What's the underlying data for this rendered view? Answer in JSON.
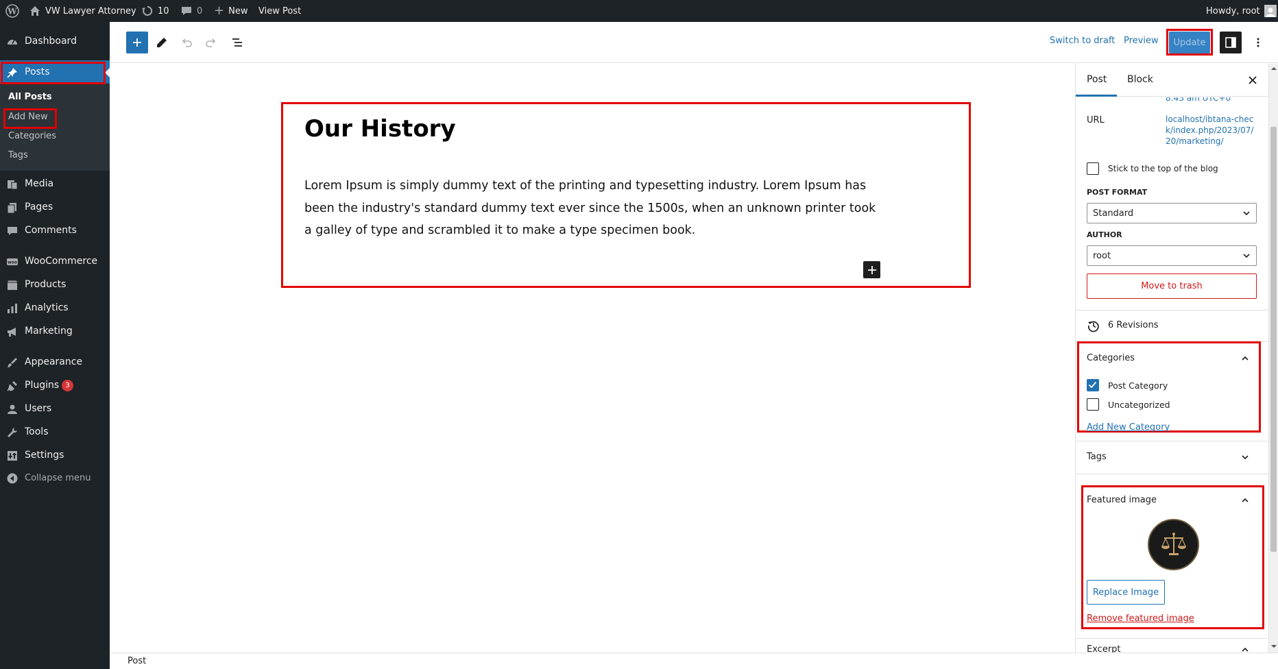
{
  "adminbar": {
    "site_name": "VW Lawyer Attorney",
    "updates_count": "10",
    "comments_count": "0",
    "new_label": "New",
    "view_post_label": "View Post",
    "howdy": "Howdy, root"
  },
  "sidebar": {
    "dashboard": "Dashboard",
    "posts": "Posts",
    "sub_all_posts": "All Posts",
    "sub_add_new": "Add New",
    "sub_categories": "Categories",
    "sub_tags": "Tags",
    "media": "Media",
    "pages": "Pages",
    "comments": "Comments",
    "woocommerce": "WooCommerce",
    "products": "Products",
    "analytics": "Analytics",
    "marketing": "Marketing",
    "appearance": "Appearance",
    "plugins": "Plugins",
    "plugins_badge": "3",
    "users": "Users",
    "tools": "Tools",
    "settings": "Settings",
    "collapse": "Collapse menu"
  },
  "header": {
    "switch_to_draft": "Switch to draft",
    "preview": "Preview",
    "update": "Update"
  },
  "post": {
    "title": "Our History",
    "paragraph": "Lorem Ipsum is simply dummy text of the printing and typesetting industry. Lorem Ipsum has been the industry's standard dummy text ever since the 1500s, when an unknown printer took a galley of type and scrambled it to make a type specimen book."
  },
  "settings": {
    "tab_post": "Post",
    "tab_block": "Block",
    "publish_time_partial": "8:43 am UTC+0",
    "url_label": "URL",
    "url_value": "localhost/ibtana-check/index.php/2023/07/20/marketing/",
    "stick_top": "Stick to the top of the blog",
    "post_format_label": "POST FORMAT",
    "post_format_value": "Standard",
    "author_label": "AUTHOR",
    "author_value": "root",
    "move_to_trash": "Move to trash",
    "revisions": "6 Revisions",
    "categories_title": "Categories",
    "categories": [
      {
        "label": "Post Category",
        "checked": true
      },
      {
        "label": "Uncategorized",
        "checked": false
      }
    ],
    "add_new_category": "Add New Category",
    "tags_title": "Tags",
    "featured_image_title": "Featured image",
    "replace_image": "Replace Image",
    "remove_featured_image": "Remove featured image",
    "excerpt_partial": "Excerpt"
  },
  "footer": {
    "breadcrumb": "Post"
  },
  "colors": {
    "admin_dark": "#1d2327",
    "accent_blue": "#2271b1",
    "annotation_red": "#e00000",
    "trash_red": "#cc1818"
  }
}
